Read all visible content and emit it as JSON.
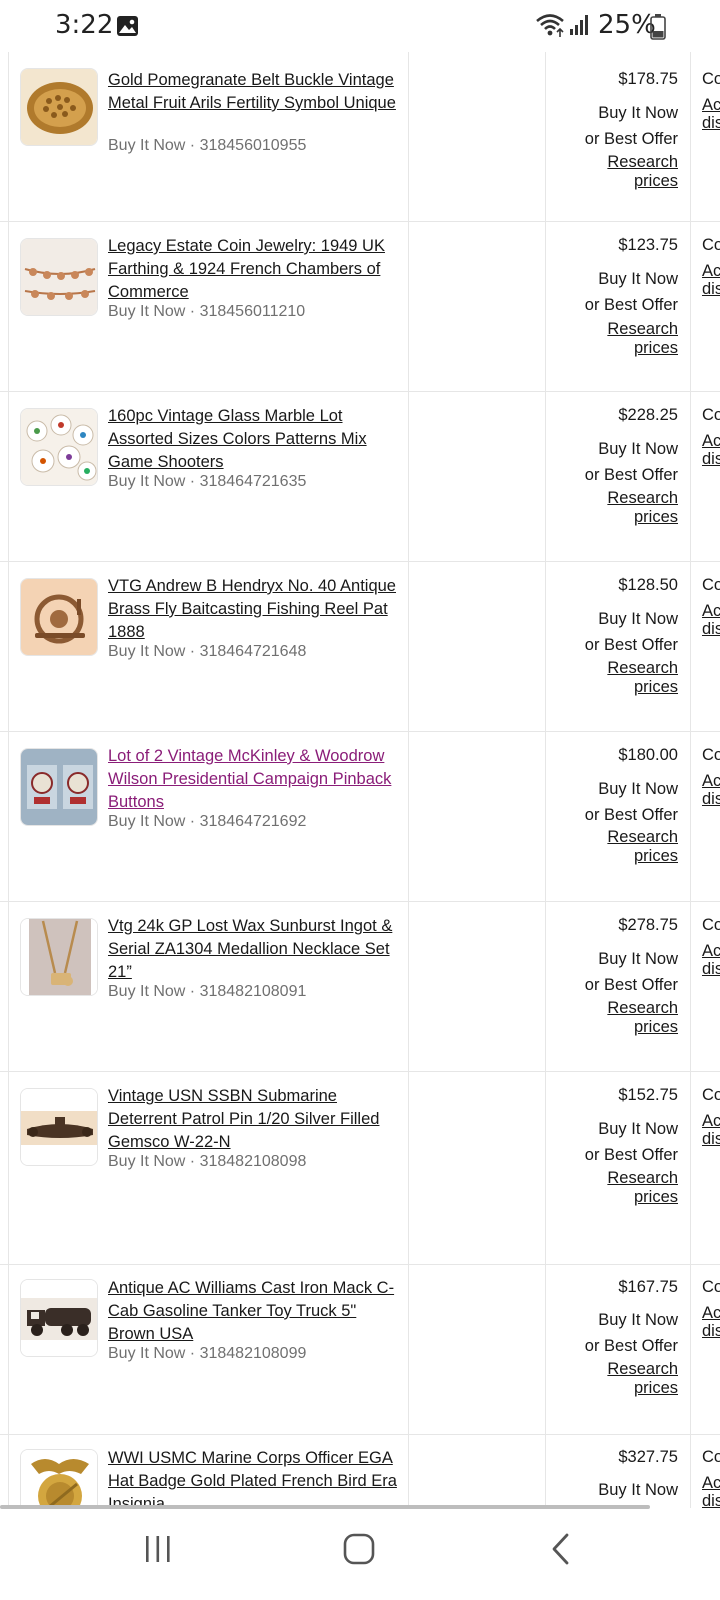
{
  "status": {
    "time": "3:22",
    "battery": "25%",
    "icons": [
      "image-icon",
      "wifi-icon",
      "signal-icon",
      "battery-icon"
    ]
  },
  "listings": [
    {
      "title": "Gold Pomegranate Belt Buckle Vintage Metal Fruit Arils Fertility Symbol Unique",
      "meta": "Buy It Now · 318456010955",
      "price": "$178.75",
      "format": "Buy It Now",
      "offer": "or Best Offer",
      "research": "Research prices",
      "col_clip": "Co",
      "link_clip": "Ac dis",
      "visited": false,
      "thumb": "belt-buckle"
    },
    {
      "title": "Legacy Estate Coin Jewelry: 1949 UK Farthing & 1924 French Chambers of Commerce",
      "meta": "Buy It Now · 318456011210",
      "price": "$123.75",
      "format": "Buy It Now",
      "offer": "or Best Offer",
      "research": "Research prices",
      "col_clip": "Co",
      "link_clip": "Ac dis",
      "visited": false,
      "thumb": "coin-jewelry"
    },
    {
      "title": "160pc Vintage Glass Marble Lot Assorted Sizes Colors Patterns Mix Game Shooters",
      "meta": "Buy It Now · 318464721635",
      "price": "$228.25",
      "format": "Buy It Now",
      "offer": "or Best Offer",
      "research": "Research prices",
      "col_clip": "Co",
      "link_clip": "Ac dis",
      "visited": false,
      "thumb": "marbles"
    },
    {
      "title": "VTG Andrew B Hendryx No. 40 Antique Brass Fly Baitcasting Fishing Reel Pat 1888",
      "meta": "Buy It Now · 318464721648",
      "price": "$128.50",
      "format": "Buy It Now",
      "offer": "or Best Offer",
      "research": "Research prices",
      "col_clip": "Co",
      "link_clip": "Ac dis",
      "visited": false,
      "thumb": "fishing-reel"
    },
    {
      "title": "Lot of 2 Vintage McKinley & Woodrow Wilson Presidential Campaign Pinback Buttons",
      "meta": "Buy It Now · 318464721692",
      "price": "$180.00",
      "format": "Buy It Now",
      "offer": "or Best Offer",
      "research": "Research prices",
      "col_clip": "Co",
      "link_clip": "Ac dis",
      "visited": true,
      "thumb": "pinback-buttons"
    },
    {
      "title": "Vtg 24k GP Lost Wax Sunburst Ingot & Serial ZA1304 Medallion Necklace Set 21”",
      "meta": "Buy It Now · 318482108091",
      "price": "$278.75",
      "format": "Buy It Now",
      "offer": "or Best Offer",
      "research": "Research prices",
      "col_clip": "Co",
      "link_clip": "Ac dis",
      "visited": false,
      "thumb": "necklace"
    },
    {
      "title": "Vintage USN SSBN Submarine Deterrent Patrol Pin 1/20 Silver Filled Gemsco W-22-N",
      "meta": "Buy It Now · 318482108098",
      "price": "$152.75",
      "format": "Buy It Now",
      "offer": "or Best Offer",
      "research": "Research prices",
      "col_clip": "Co",
      "link_clip": "Ac dis",
      "visited": false,
      "thumb": "submarine-pin"
    },
    {
      "title": "Antique AC Williams Cast Iron Mack C-Cab Gasoline Tanker Toy Truck 5\" Brown USA",
      "meta": "Buy It Now · 318482108099",
      "price": "$167.75",
      "format": "Buy It Now",
      "offer": "or Best Offer",
      "research": "Research prices",
      "col_clip": "Co",
      "link_clip": "Ac dis",
      "visited": false,
      "thumb": "toy-truck"
    },
    {
      "title": "WWI USMC Marine Corps Officer EGA Hat Badge Gold Plated French Bird Era Insignia",
      "meta": "",
      "price": "$327.75",
      "format": "Buy It Now",
      "offer": "",
      "research": "",
      "col_clip": "Co",
      "link_clip": "Ac dis",
      "visited": false,
      "thumb": "ega-badge"
    }
  ],
  "nav": {
    "icons": [
      "recent-apps-icon",
      "home-icon",
      "back-icon"
    ]
  }
}
